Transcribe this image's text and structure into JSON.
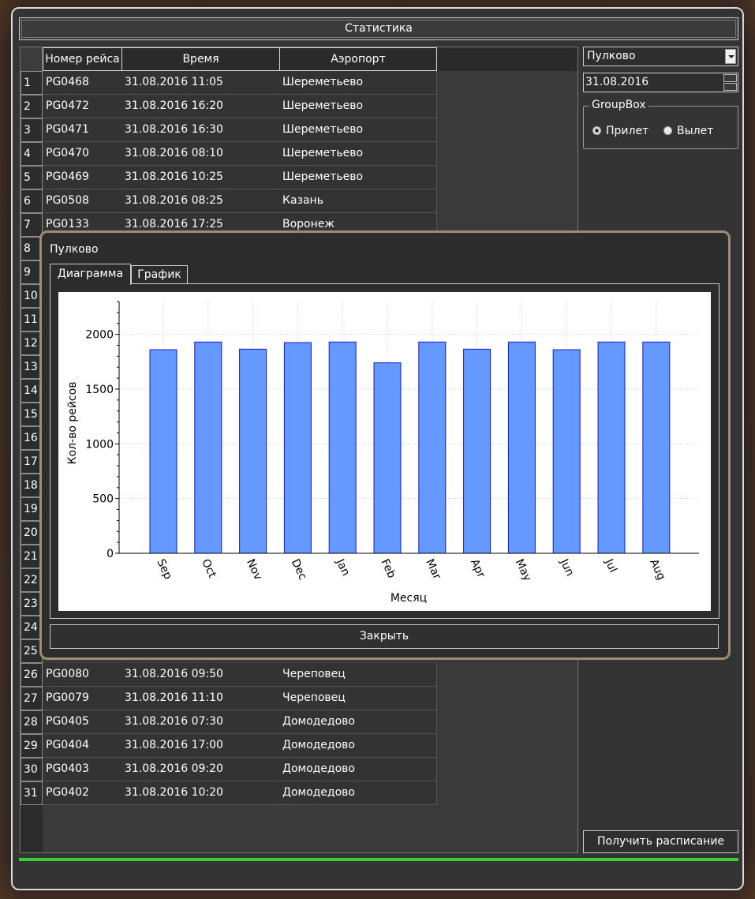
{
  "window": {
    "title_button": "Статистика"
  },
  "table": {
    "headers": [
      "Номер рейса",
      "Время",
      "Аэропорт"
    ],
    "row_numbers": [
      "1",
      "2",
      "3",
      "4",
      "5",
      "6",
      "7",
      "8",
      "9",
      "10",
      "11",
      "12",
      "13",
      "14",
      "15",
      "16",
      "17",
      "18",
      "19",
      "20",
      "21",
      "22",
      "23",
      "24",
      "25",
      "26",
      "27",
      "28",
      "29",
      "30",
      "31"
    ],
    "top_rows": [
      {
        "flight": "PG0468",
        "time": "31.08.2016 11:05",
        "airport": "Шереметьево"
      },
      {
        "flight": "PG0472",
        "time": "31.08.2016 16:20",
        "airport": "Шереметьево"
      },
      {
        "flight": "PG0471",
        "time": "31.08.2016 16:30",
        "airport": "Шереметьево"
      },
      {
        "flight": "PG0470",
        "time": "31.08.2016 08:10",
        "airport": "Шереметьево"
      },
      {
        "flight": "PG0469",
        "time": "31.08.2016 10:25",
        "airport": "Шереметьево"
      },
      {
        "flight": "PG0508",
        "time": "31.08.2016 08:25",
        "airport": "Казань"
      },
      {
        "flight": "PG0133",
        "time": "31.08.2016 17:25",
        "airport": "Воронеж"
      }
    ],
    "bottom_rows": [
      {
        "flight": "PG0080",
        "time": "31.08.2016 09:50",
        "airport": "Череповец"
      },
      {
        "flight": "PG0079",
        "time": "31.08.2016 11:10",
        "airport": "Череповец"
      },
      {
        "flight": "PG0405",
        "time": "31.08.2016 07:30",
        "airport": "Домодедово"
      },
      {
        "flight": "PG0404",
        "time": "31.08.2016 17:00",
        "airport": "Домодедово"
      },
      {
        "flight": "PG0403",
        "time": "31.08.2016 09:20",
        "airport": "Домодедово"
      },
      {
        "flight": "PG0402",
        "time": "31.08.2016 10:20",
        "airport": "Домодедово"
      }
    ]
  },
  "controls": {
    "airport_select": "Пулково",
    "date": "31.08.2016",
    "groupbox_title": "GroupBox",
    "radio_arrival": "Прилет",
    "radio_departure": "Вылет",
    "get_schedule": "Получить расписание"
  },
  "dialog": {
    "title": "Пулково",
    "tabs": [
      "Диаграмма",
      "График"
    ],
    "active_tab": "Диаграмма",
    "close": "Закрыть"
  },
  "colors": {
    "bar_fill": "#6699ff",
    "bar_stroke": "#1a1acc",
    "progress": "#35d035"
  },
  "chart_data": {
    "type": "bar",
    "categories": [
      "Sep",
      "Oct",
      "Nov",
      "Dec",
      "Jan",
      "Feb",
      "Mar",
      "Apr",
      "May",
      "Jun",
      "Jul",
      "Aug"
    ],
    "values": [
      1860,
      1930,
      1865,
      1925,
      1930,
      1740,
      1930,
      1865,
      1930,
      1860,
      1930,
      1930
    ],
    "xlabel": "Месяц",
    "ylabel": "Кол-во рейсов",
    "y_ticks": [
      0,
      500,
      1000,
      1500,
      2000
    ],
    "ylim": [
      0,
      2300
    ],
    "grid": true
  }
}
